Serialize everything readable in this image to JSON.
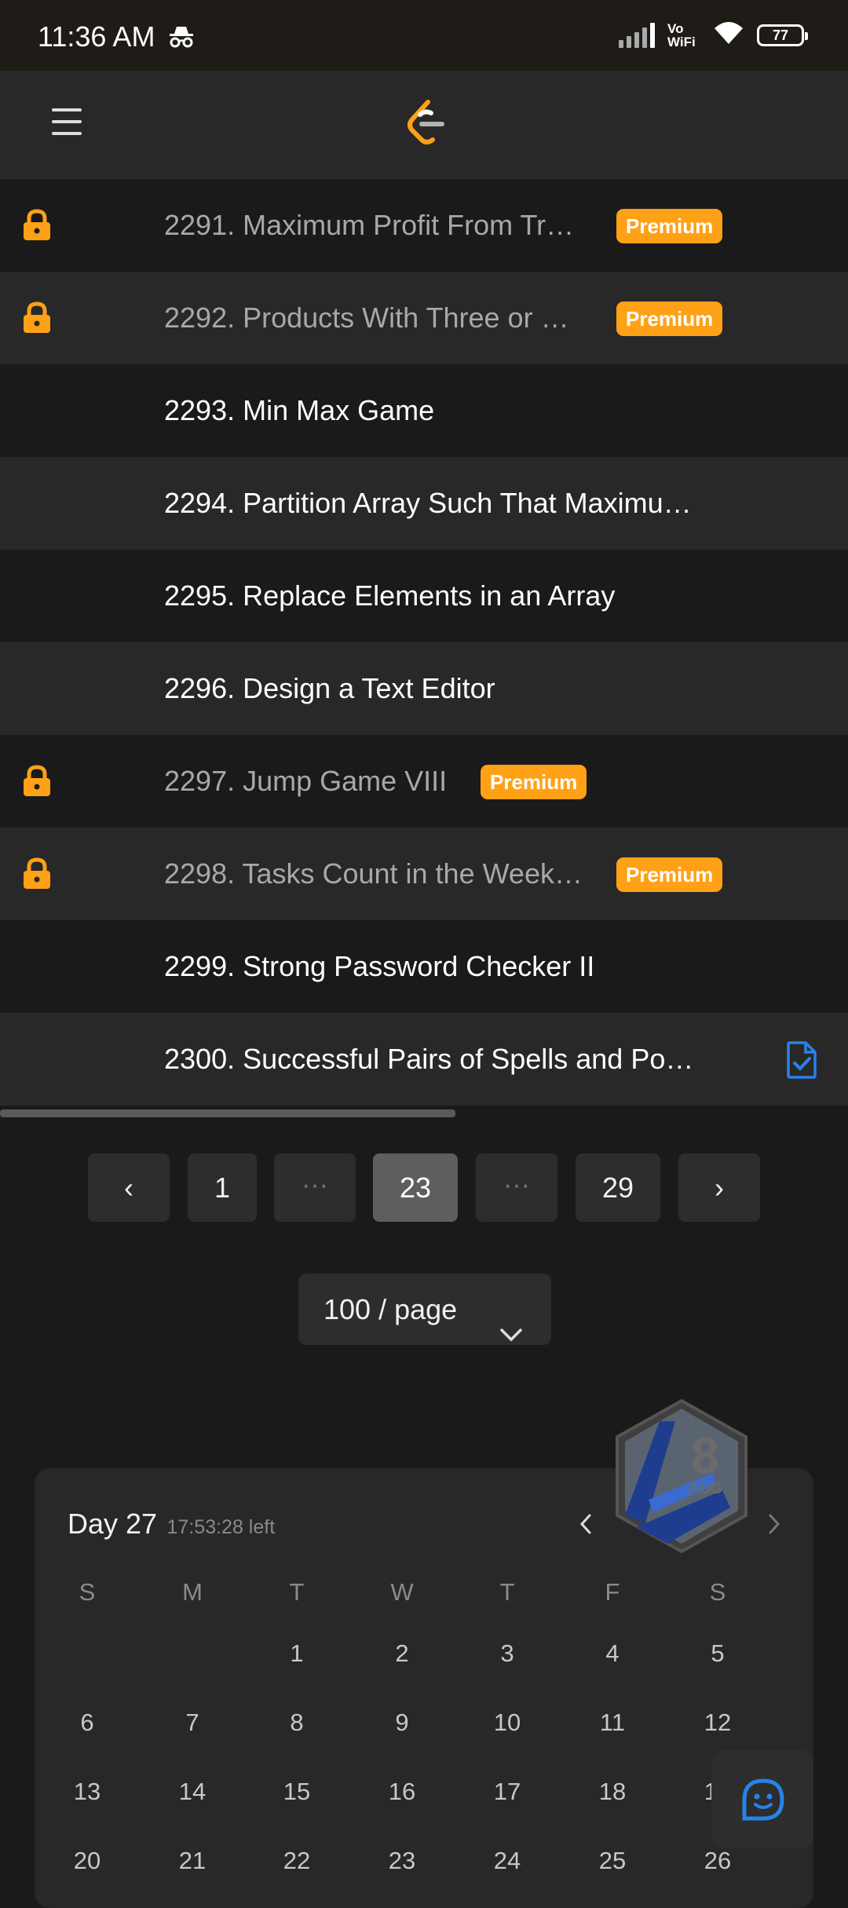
{
  "status_bar": {
    "time": "11:36 AM",
    "battery": "77",
    "network_label": "Vo WiFi"
  },
  "header": {
    "menu_icon": "hamburger-icon",
    "logo_icon": "leetcode-logo"
  },
  "problems": [
    {
      "title": "2291. Maximum Profit From Tr…",
      "locked": true,
      "premium": "Premium"
    },
    {
      "title": "2292. Products With Three or …",
      "locked": true,
      "premium": "Premium"
    },
    {
      "title": "2293. Min Max Game",
      "locked": false
    },
    {
      "title": "2294. Partition Array Such That Maximu…",
      "locked": false
    },
    {
      "title": "2295. Replace Elements in an Array",
      "locked": false
    },
    {
      "title": "2296. Design a Text Editor",
      "locked": false
    },
    {
      "title": "2297. Jump Game VIII",
      "locked": true,
      "premium": "Premium"
    },
    {
      "title": "2298. Tasks Count in the Week…",
      "locked": true,
      "premium": "Premium"
    },
    {
      "title": "2299. Strong Password Checker II",
      "locked": false
    },
    {
      "title": "2300. Successful Pairs of Spells and Po…",
      "locked": false,
      "solution_icon": "solution-doc-icon"
    }
  ],
  "pagination": {
    "prev": "‹",
    "first": "1",
    "ellipsis": "···",
    "current": "23",
    "last": "29",
    "next": "›"
  },
  "page_size": {
    "label": "100 / page"
  },
  "calendar": {
    "day_label": "Day 27",
    "time_left": "17:53:28 left",
    "badge_day": "8",
    "badge_month": "AUG",
    "weekdays": [
      "S",
      "M",
      "T",
      "W",
      "T",
      "F",
      "S"
    ],
    "weeks": [
      [
        "",
        "",
        "1",
        "2",
        "3",
        "4",
        "5"
      ],
      [
        "6",
        "7",
        "8",
        "9",
        "10",
        "11",
        "12"
      ],
      [
        "13",
        "14",
        "15",
        "16",
        "17",
        "18",
        "19"
      ],
      [
        "20",
        "21",
        "22",
        "23",
        "24",
        "25",
        "26"
      ]
    ]
  },
  "colors": {
    "premium": "#ffa116",
    "accent_blue": "#2883e8",
    "background": "#1a1a1a"
  }
}
